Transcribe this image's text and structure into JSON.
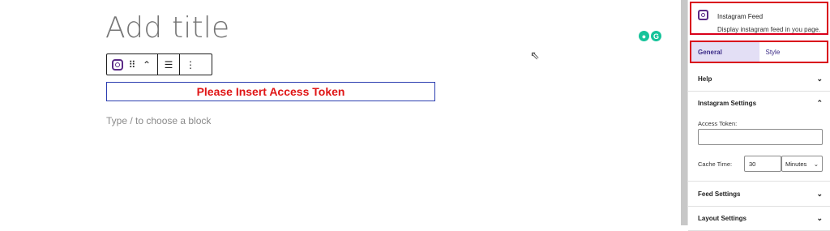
{
  "editor": {
    "title_placeholder": "Add title",
    "block_message": "Please Insert Access Token",
    "appender_placeholder": "Type / to choose a block",
    "toolbar": {
      "block_icon": "instagram-icon",
      "drag_icon": "drag-handle-icon",
      "move_icon": "move-up-down-icon",
      "align_icon": "align-center-icon",
      "more_icon": "more-vertical-icon"
    }
  },
  "sidebar": {
    "block_card": {
      "name": "Instagram Feed",
      "description": "Display instagram feed in you page."
    },
    "tabs": [
      {
        "label": "General",
        "active": true
      },
      {
        "label": "Style",
        "active": false
      }
    ],
    "panels": {
      "help": "Help",
      "instagram_settings": "Instagram Settings",
      "access_token_label": "Access Token:",
      "access_token_value": "",
      "cache_time_label": "Cache Time:",
      "cache_time_value": "30",
      "cache_unit": "Minutes",
      "feed_settings": "Feed Settings",
      "layout_settings": "Layout Settings"
    }
  },
  "colors": {
    "accent": "#5b2a86",
    "highlight_border": "#d9001b",
    "error_text": "#e01515",
    "tab_active_bg": "#e3dff5"
  }
}
